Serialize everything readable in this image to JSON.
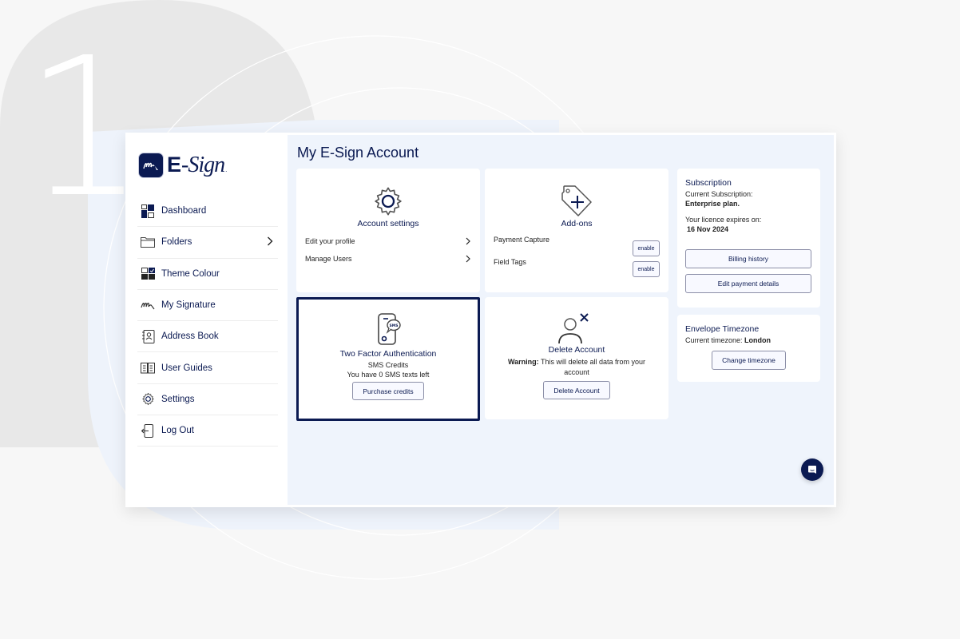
{
  "step_number": "1",
  "brand": {
    "name_prefix": "E",
    "name_suffix": "-Sign",
    "dot": "."
  },
  "sidebar": {
    "items": [
      {
        "label": "Dashboard",
        "icon": "dashboard-icon"
      },
      {
        "label": "Folders",
        "icon": "folder-icon",
        "has_chevron": true
      },
      {
        "label": "Theme Colour",
        "icon": "theme-icon"
      },
      {
        "label": "My Signature",
        "icon": "signature-icon"
      },
      {
        "label": "Address Book",
        "icon": "address-book-icon"
      },
      {
        "label": "User Guides",
        "icon": "book-icon"
      },
      {
        "label": "Settings",
        "icon": "gear-icon"
      },
      {
        "label": "Log Out",
        "icon": "logout-icon"
      }
    ]
  },
  "main": {
    "title": "My E-Sign Account",
    "account_settings": {
      "title": "Account settings",
      "links": [
        "Edit your profile",
        "Manage Users"
      ]
    },
    "addons": {
      "title": "Add-ons",
      "items": [
        {
          "label": "Payment Capture",
          "button": "enable"
        },
        {
          "label": "Field Tags",
          "button": "enable"
        }
      ]
    },
    "two_factor": {
      "title": "Two Factor Authentication",
      "subtitle": "SMS Credits",
      "text": "You have 0 SMS texts left",
      "button": "Purchase credits",
      "sms_badge": "SMS"
    },
    "delete_account": {
      "title": "Delete Account",
      "warning_label": "Warning:",
      "warning_text": " This will delete all data from your account",
      "button": "Delete Account"
    },
    "subscription": {
      "title": "Subscription",
      "current_label": "Current Subscription:",
      "current_value": "Enterprise plan.",
      "expires_label": "Your licence expires on:",
      "expires_value": "16 Nov 2024",
      "billing_button": "Billing history",
      "payment_button": "Edit payment details"
    },
    "timezone": {
      "title": "Envelope Timezone",
      "label": "Current timezone: ",
      "value": "London",
      "button": "Change timezone"
    }
  },
  "colors": {
    "brand_navy": "#0b1a52",
    "main_bg": "#eff4fc",
    "page_bg": "#f7f7f7"
  }
}
